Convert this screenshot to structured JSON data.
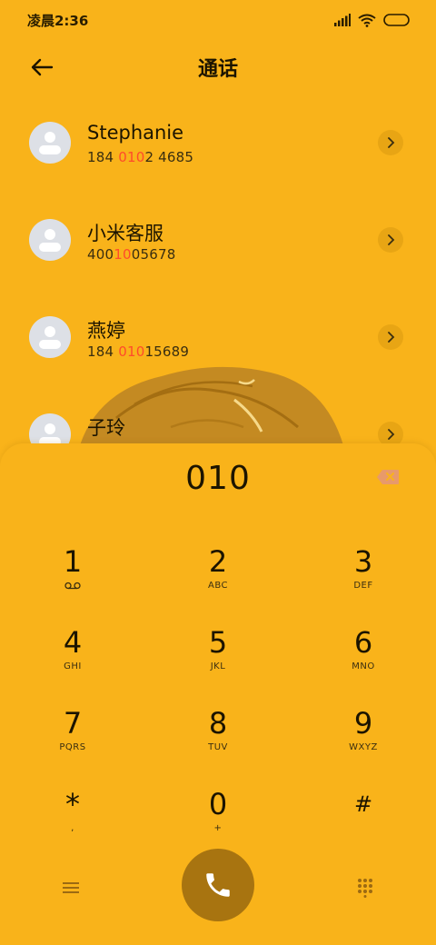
{
  "status_bar": {
    "time": "凌晨2:36"
  },
  "header": {
    "title": "通话"
  },
  "results": [
    {
      "name": "Stephanie",
      "number_parts": [
        "184 ",
        "010",
        "2 4685"
      ]
    },
    {
      "name": "小米客服",
      "number_parts": [
        "400",
        "10",
        "05678"
      ]
    },
    {
      "name": "燕婷",
      "number_parts": [
        "184 ",
        "010",
        "15689"
      ]
    },
    {
      "name": "子玲",
      "number_parts": [
        "",
        "",
        ""
      ]
    }
  ],
  "dialpad": {
    "input": "010",
    "keys": [
      {
        "digit": "1",
        "letters": ""
      },
      {
        "digit": "2",
        "letters": "ABC"
      },
      {
        "digit": "3",
        "letters": "DEF"
      },
      {
        "digit": "4",
        "letters": "GHI"
      },
      {
        "digit": "5",
        "letters": "JKL"
      },
      {
        "digit": "6",
        "letters": "MNO"
      },
      {
        "digit": "7",
        "letters": "PQRS"
      },
      {
        "digit": "8",
        "letters": "TUV"
      },
      {
        "digit": "9",
        "letters": "WXYZ"
      },
      {
        "digit": "*",
        "letters": ","
      },
      {
        "digit": "0",
        "letters": "+"
      },
      {
        "digit": "#",
        "letters": ""
      }
    ]
  },
  "colors": {
    "background": "#F9B31A",
    "highlight": "#FF4B2B",
    "call_button": "#A87410"
  },
  "icons": {
    "back": "arrow-left-icon",
    "chevron": "chevron-right-icon",
    "backspace": "backspace-icon",
    "voicemail": "voicemail-icon",
    "menu": "menu-icon",
    "call": "phone-icon",
    "dialpad": "dialpad-icon"
  }
}
